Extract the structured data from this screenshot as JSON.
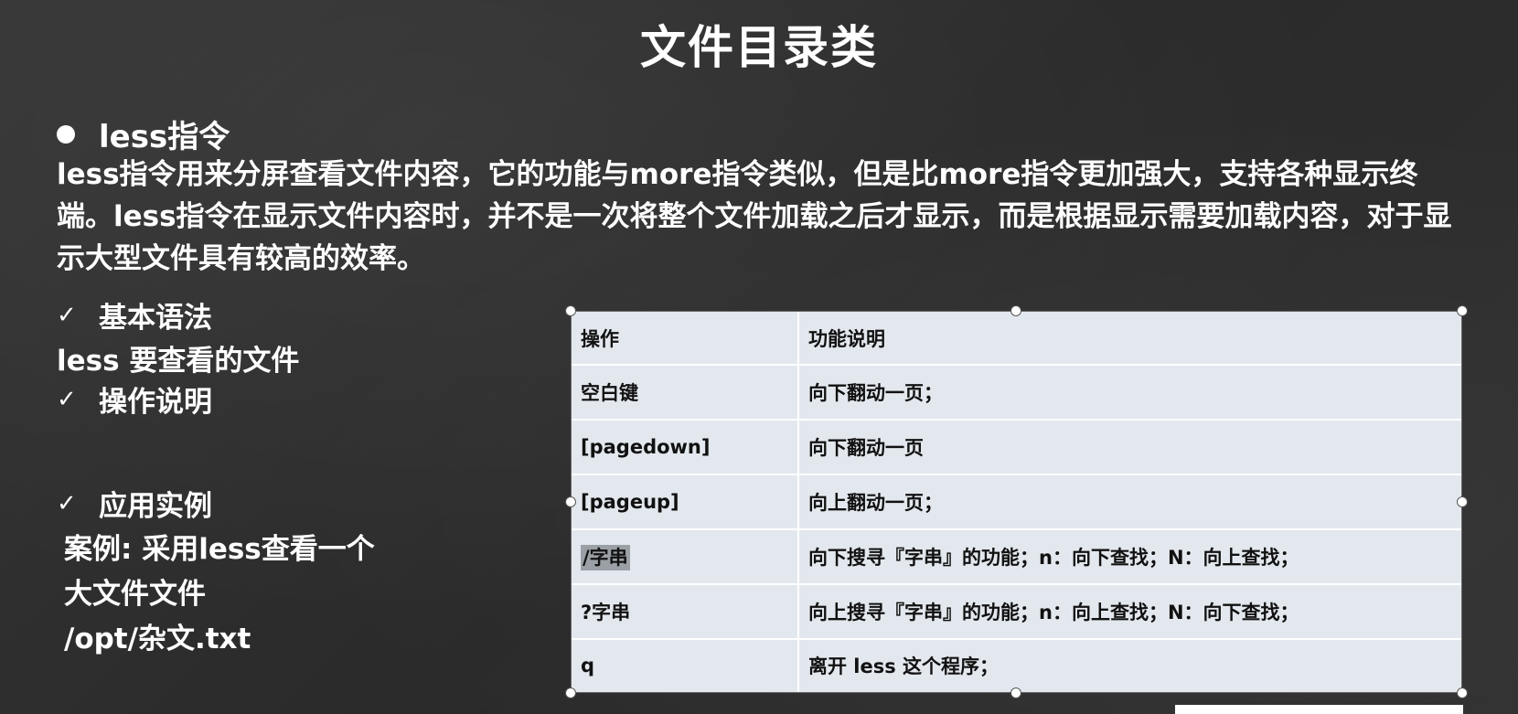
{
  "slide": {
    "title": "文件目录类",
    "heading": "less指令",
    "intro": "less指令用来分屏查看文件内容，它的功能与more指令类似，但是比more指令更加强大，支持各种显示终端。less指令在显示文件内容时，并不是一次将整个文件加载之后才显示，而是根据显示需要加载内容，对于显示大型文件具有较高的效率。"
  },
  "left": {
    "syntax_title": "基本语法",
    "syntax": "less 要查看的文件",
    "ops_title": "操作说明",
    "example_title": "应用实例",
    "example_line1": "案例: 采用less查看一个",
    "example_line2": "大文件文件",
    "example_line3": "/opt/杂文.txt"
  },
  "table": {
    "headers": [
      "操作",
      "功能说明"
    ],
    "rows": [
      [
        "空白键",
        "向下翻动一页；"
      ],
      [
        "[pagedown]",
        "向下翻动一页"
      ],
      [
        "[pageup]",
        "向上翻动一页；"
      ],
      [
        "/字串",
        "向下搜寻『字串』的功能；n：向下查找；N：向上查找；"
      ],
      [
        "?字串",
        "向上搜寻『字串』的功能；n：向上查找；N：向下查找；"
      ],
      [
        "q",
        "离开 less 这个程序；"
      ]
    ]
  },
  "colors": {
    "background": "#2e2e2e",
    "text": "#ffffff",
    "table_bg": "#e3e8ee",
    "highlight": "#9aa0a6"
  },
  "icons": {
    "bullet": "bullet-dot-icon",
    "check": "checkmark-icon"
  }
}
